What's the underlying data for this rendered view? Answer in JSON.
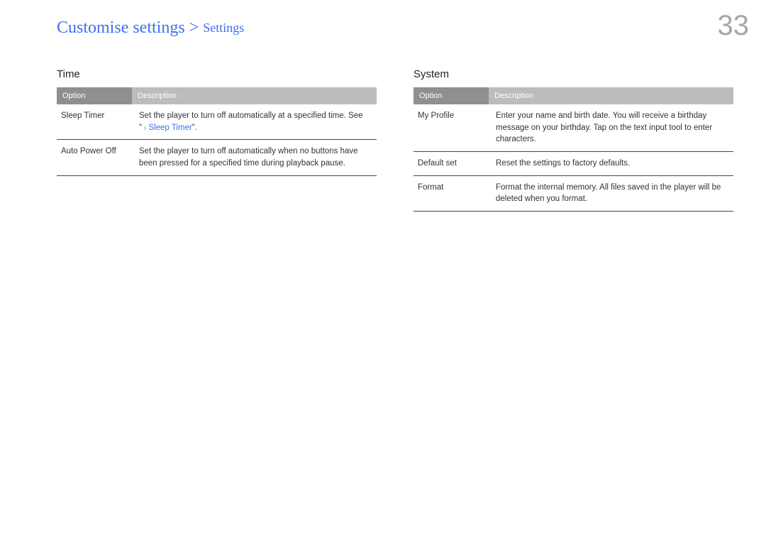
{
  "breadcrumb": {
    "main": "Customise settings",
    "separator": ">",
    "sub": "Settings"
  },
  "page_number": "33",
  "left": {
    "title": "Time",
    "header": {
      "col1": "Option",
      "col2": "Description"
    },
    "rows": [
      {
        "c1": "Sleep Timer",
        "c2_pre": "Set the player to turn off automatically at a specified time. See \"",
        "c2_link": "Sleep Timer",
        "c2_post": "\"."
      },
      {
        "c1": "Auto Power Off",
        "c2_pre": "Set the player to turn off automatically when no buttons have been pressed for a specified time during playback pause.",
        "c2_link": "",
        "c2_post": ""
      }
    ]
  },
  "right": {
    "title": "System",
    "header": {
      "col1": "Option",
      "col2": "Description"
    },
    "rows": [
      {
        "c1": "My Profile",
        "c2": "Enter your name and birth date. You will receive a birthday message on your birthday. Tap on the text input tool to enter characters."
      },
      {
        "c1": "Default set",
        "c2": "Reset the settings to factory defaults."
      },
      {
        "c1": "Format",
        "c2": "Format the internal memory. All files saved in the player will be deleted when you format."
      }
    ]
  }
}
